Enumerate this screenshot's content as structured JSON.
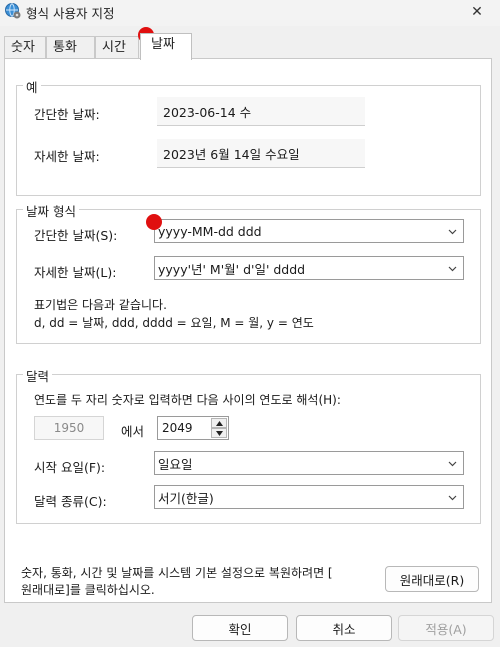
{
  "window": {
    "title": "형식 사용자 지정",
    "close_glyph": "✕",
    "icon": "globe-settings-icon"
  },
  "tabs": [
    {
      "label": "숫자"
    },
    {
      "label": "통화"
    },
    {
      "label": "시간"
    },
    {
      "label": "날짜",
      "active": true
    }
  ],
  "example": {
    "title": "예",
    "short_label": "간단한 날짜:",
    "short_value": "2023-06-14 수",
    "long_label": "자세한 날짜:",
    "long_value": "2023년 6월 14일 수요일"
  },
  "date_format": {
    "title": "날짜 형식",
    "short_label": "간단한 날짜(S):",
    "short_value": "yyyy-MM-dd ddd",
    "long_label": "자세한 날짜(L):",
    "long_value": "yyyy'년' M'월' d'일' dddd",
    "notation_line1": "표기법은 다음과 같습니다.",
    "notation_line2": "d, dd = 날짜,  ddd, dddd = 요일,  M = 월,  y = 연도"
  },
  "calendar": {
    "title": "달력",
    "two_digit_text": "연도를 두 자리 숫자로 입력하면 다음 사이의 연도로 해석(H):",
    "year_from": "1950",
    "between_label": "에서",
    "year_to": "2049",
    "first_day_label": "시작 요일(F):",
    "first_day_value": "일요일",
    "calendar_type_label": "달력 종류(C):",
    "calendar_type_value": "서기(한글)"
  },
  "reset": {
    "text_line1": "숫자, 통화, 시간 및 날짜를 시스템 기본 설정으로 복원하려면 [",
    "text_line2": "원래대로]를 클릭하십시오.",
    "button_label": "원래대로(R)"
  },
  "footer": {
    "ok": "확인",
    "cancel": "취소",
    "apply": "적용(A)"
  },
  "colors": {
    "marker": "#e01010",
    "panel": "#ffffff",
    "window": "#f0f0f0"
  }
}
